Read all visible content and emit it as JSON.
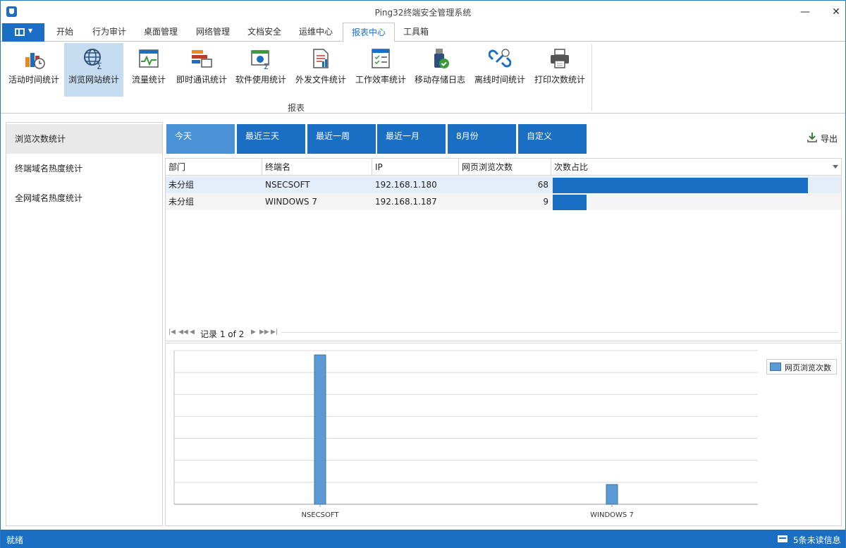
{
  "window": {
    "title": "Ping32终端安全管理系统"
  },
  "tabs": [
    "开始",
    "行为审计",
    "桌面管理",
    "网络管理",
    "文档安全",
    "运维中心",
    "报表中心",
    "工具箱"
  ],
  "active_tab": "报表中心",
  "ribbon": {
    "group_label": "报表",
    "buttons": [
      {
        "label": "活动时间统计",
        "icon": "activity-time-icon"
      },
      {
        "label": "浏览网站统计",
        "icon": "web-browse-icon"
      },
      {
        "label": "流量统计",
        "icon": "traffic-icon"
      },
      {
        "label": "即时通讯统计",
        "icon": "im-icon"
      },
      {
        "label": "软件使用统计",
        "icon": "software-icon"
      },
      {
        "label": "外发文件统计",
        "icon": "outgoing-file-icon"
      },
      {
        "label": "工作效率统计",
        "icon": "efficiency-icon"
      },
      {
        "label": "移动存储日志",
        "icon": "usb-storage-icon"
      },
      {
        "label": "离线时间统计",
        "icon": "offline-time-icon"
      },
      {
        "label": "打印次数统计",
        "icon": "printer-icon"
      }
    ]
  },
  "left_nav": {
    "items": [
      "浏览次数统计",
      "终端域名热度统计",
      "全网域名热度统计"
    ]
  },
  "ranges": [
    "今天",
    "最近三天",
    "最近一周",
    "最近一月",
    "8月份",
    "自定义"
  ],
  "export_label": "导出",
  "grid": {
    "columns": [
      "部门",
      "终端名",
      "IP",
      "网页浏览次数",
      "次数占比"
    ],
    "rows": [
      {
        "dept": "未分组",
        "name": "NSECSOFT",
        "ip": "192.168.1.180",
        "count": "68",
        "ratio": 0.883
      },
      {
        "dept": "未分组",
        "name": "WINDOWS 7",
        "ip": "192.168.1.187",
        "count": "9",
        "ratio": 0.117
      }
    ]
  },
  "pager": {
    "text": "记录 1 of 2"
  },
  "status": {
    "left": "就绪",
    "messages": "5条未读信息"
  },
  "colors": {
    "accent": "#1a6fc4",
    "bar": "#5b9bd5"
  },
  "chart_data": {
    "type": "bar",
    "categories": [
      "NSECSOFT",
      "WINDOWS 7"
    ],
    "series": [
      {
        "name": "网页浏览次数",
        "values": [
          68,
          9
        ]
      }
    ],
    "ylim": [
      0,
      70
    ],
    "legend": "top-right",
    "grid": true
  }
}
